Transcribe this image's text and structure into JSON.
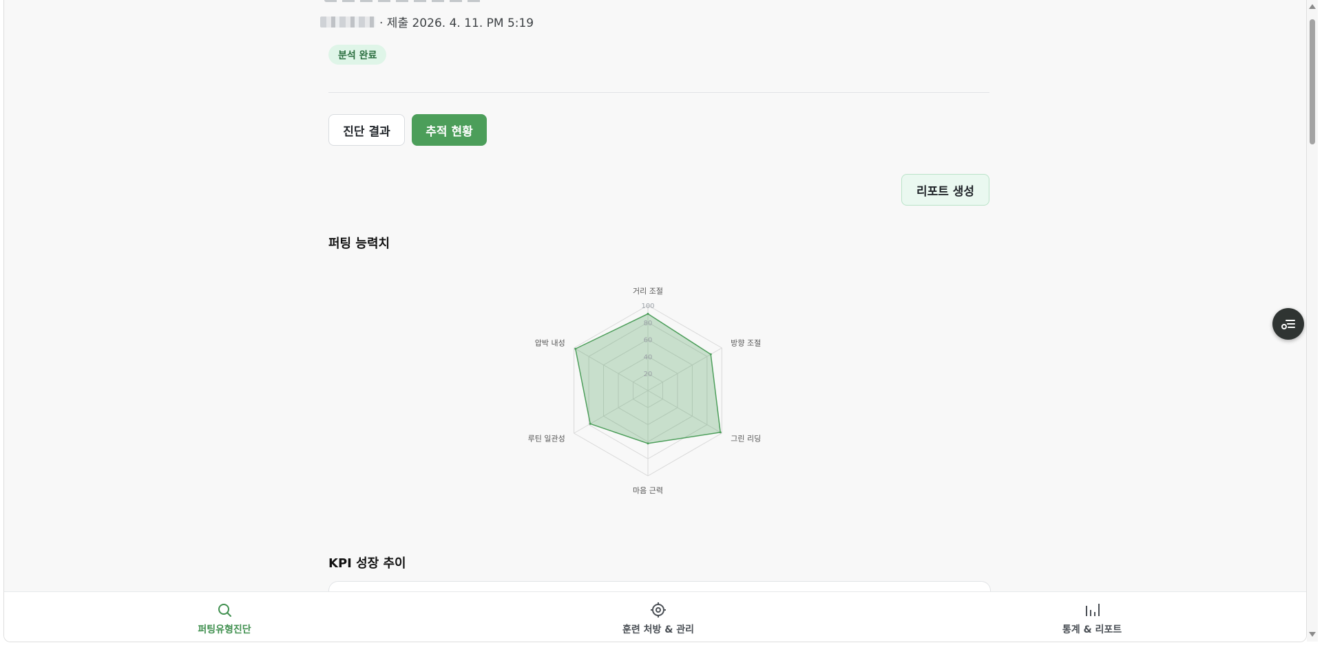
{
  "header": {
    "submitted_text": "· 제출 2026. 4. 11. PM 5:19",
    "status_badge": "분석 완료"
  },
  "tabs": [
    {
      "label": "진단 결과",
      "active": false
    },
    {
      "label": "추적 현황",
      "active": true
    }
  ],
  "actions": {
    "report_button": "리포트 생성"
  },
  "putting_section": {
    "title": "퍼팅 능력치"
  },
  "chart_data": {
    "type": "radar",
    "axes": [
      "거리 조절",
      "방향 조절",
      "그린 리딩",
      "마음 근력",
      "루틴 일관성",
      "압박 내성"
    ],
    "values": [
      90,
      85,
      98,
      62,
      78,
      98
    ],
    "rlim": [
      0,
      100
    ],
    "ticks": [
      "20",
      "40",
      "60",
      "80",
      "100"
    ],
    "fill_color": "#4c9e5a",
    "grid": true
  },
  "kpi_section": {
    "title": "KPI 성장 추이"
  },
  "bottom_nav": [
    {
      "label": "퍼팅유형진단",
      "icon": "search-icon",
      "active": true
    },
    {
      "label": "훈련 처방 & 관리",
      "icon": "target-icon",
      "active": false
    },
    {
      "label": "통계 & 리포트",
      "icon": "bar-chart-icon",
      "active": false
    }
  ],
  "colors": {
    "accent": "#4c9e5a",
    "badge_bg": "#dff5e8",
    "fab_bg": "#2f3432"
  }
}
